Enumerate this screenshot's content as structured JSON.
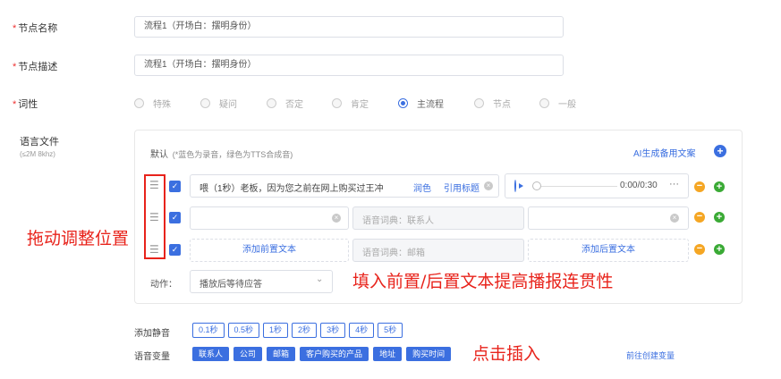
{
  "form": {
    "node_name_label": "节点名称",
    "node_name_value": "流程1（开场白：摆明身份）",
    "node_desc_label": "节点描述",
    "node_desc_value": "流程1（开场白：摆明身份）",
    "pos_label": "词性",
    "pos_options": [
      "特殊",
      "疑问",
      "否定",
      "肯定",
      "主流程",
      "节点",
      "一般"
    ],
    "pos_selected": "主流程",
    "audio_label": "语言文件",
    "audio_hint": "(≤2M 8khz)"
  },
  "audio_box": {
    "default_label": "默认",
    "default_hint": "(*蓝色为录音，绿色为TTS合成音)",
    "ai_button": "AI生成备用文案",
    "row1": {
      "text": "喂（1秒）老板，因为您之前在网上购买过王冲",
      "polish": "润色",
      "quote": "引用标题",
      "time": "0:00/0:30",
      "more": "···"
    },
    "row2": {
      "mid_placeholder": "语音词典：联系人"
    },
    "row3": {
      "add_prefix": "添加前置文本",
      "mid_placeholder": "语音词典：邮箱",
      "add_suffix": "添加后置文本"
    },
    "action_label": "动作：",
    "action_value": "播放后等待应答"
  },
  "silence": {
    "label": "添加静音",
    "items": [
      "0.1秒",
      "0.5秒",
      "1秒",
      "2秒",
      "3秒",
      "4秒",
      "5秒"
    ]
  },
  "variables": {
    "label": "语音变量",
    "items": [
      "联系人",
      "公司",
      "邮箱",
      "客户购买的产品",
      "地址",
      "购买时间"
    ],
    "create_link": "前往创建变量"
  },
  "annotations": {
    "drag": "拖动调整位置",
    "fill": "填入前置/后置文本提高播报连贯性",
    "click": "点击插入"
  },
  "colors": {
    "accent": "#3b6fe0",
    "annotation": "#e8231b",
    "required": "#e33"
  }
}
